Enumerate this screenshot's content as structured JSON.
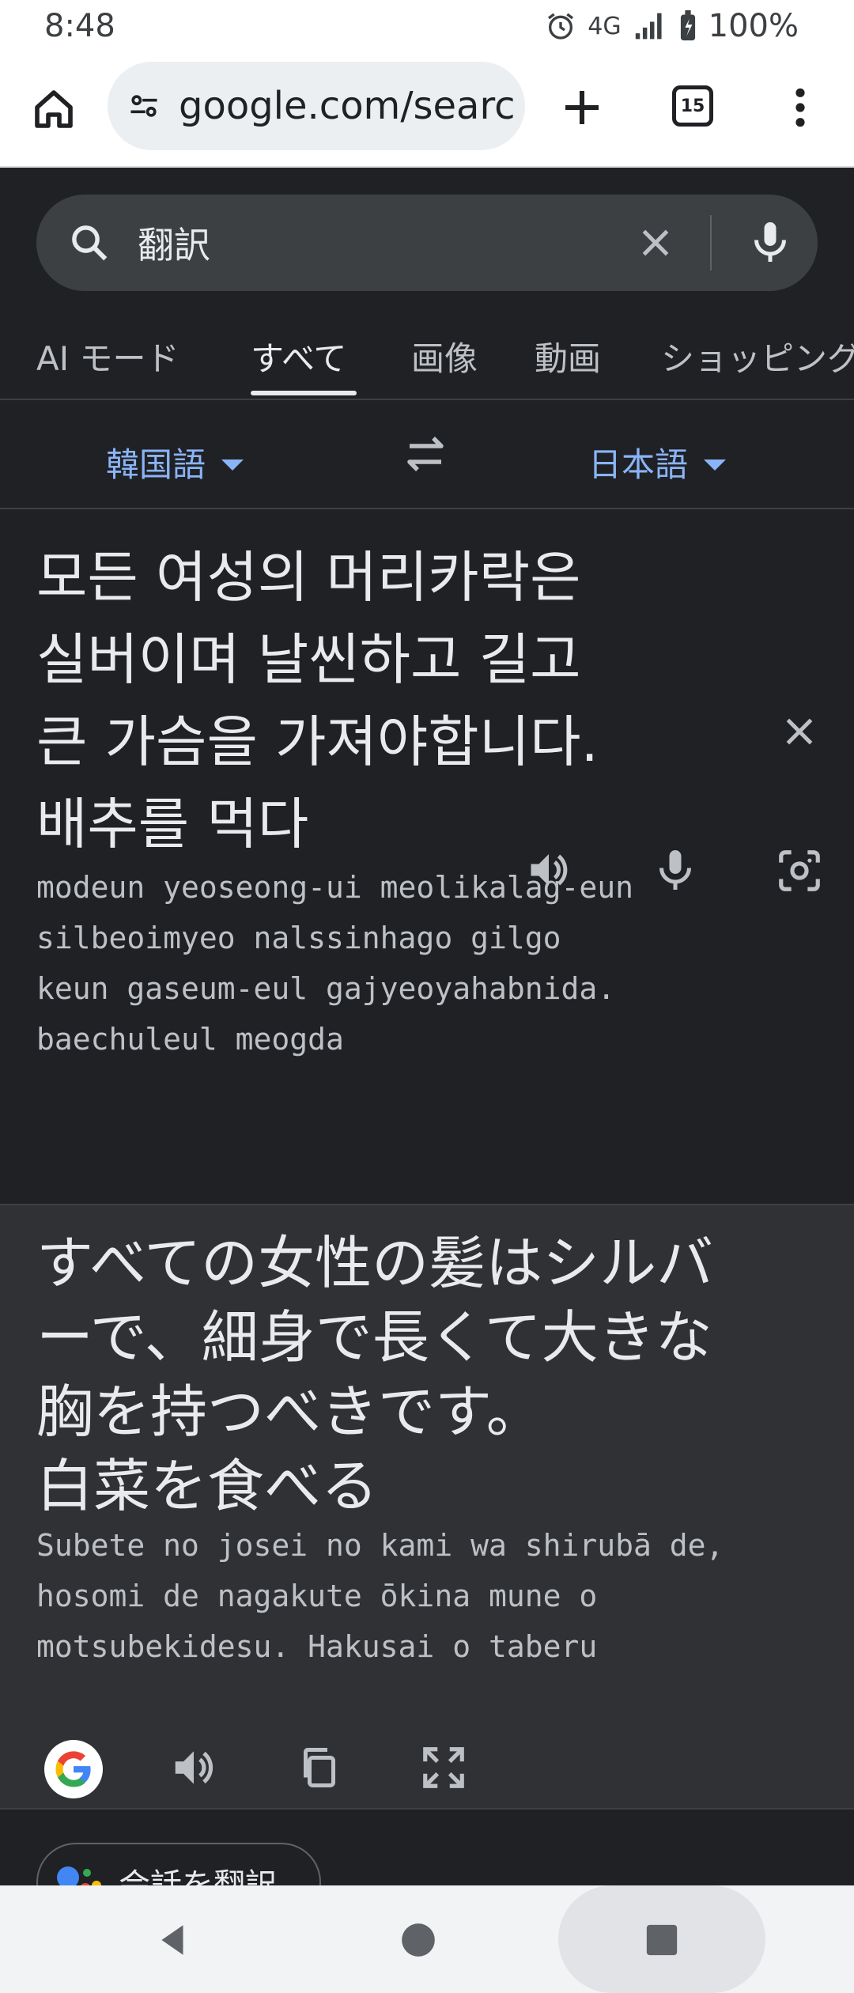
{
  "status_bar": {
    "time": "8:48",
    "network": "4G",
    "battery": "100%"
  },
  "browser": {
    "url": "google.com/searc",
    "tab_count": "15"
  },
  "search": {
    "query": "翻訳"
  },
  "tabs": [
    "AI モード",
    "すべて",
    "画像",
    "動画",
    "ショッピング"
  ],
  "translator": {
    "source_lang": "韓国語",
    "target_lang": "日本語",
    "source_lines": [
      "모든 여성의 머리카락은",
      "실버이며 날씬하고 길고",
      "큰 가슴을 가져야합니다.",
      "배추를 먹다"
    ],
    "source_roman_lines": [
      "modeun yeoseong-ui meolikalag-eun",
      "silbeoimyeo nalssinhago gilgo",
      "keun gaseum-eul gajyeoyahabnida.",
      "baechuleul meogda"
    ],
    "target_lines": [
      "すべての女性の髪はシルバ",
      "ーで、細身で長くて大きな",
      "胸を持つべきです。",
      "白菜を食べる"
    ],
    "target_roman_lines": [
      "Subete no josei no kami wa shirubā de,",
      "hosomi de nagakute ōkina mune o",
      "motsubekidesu. Hakusai o taberu"
    ]
  },
  "conversation_chip": "会話を翻訳",
  "icons": [
    "home-icon",
    "site-info-icon",
    "new-tab-icon",
    "tab-switcher-icon",
    "more-menu-icon",
    "search-icon",
    "clear-icon",
    "mic-icon",
    "swap-icon",
    "close-icon",
    "speaker-icon",
    "camera-icon",
    "google-g-icon",
    "copy-icon",
    "fullscreen-icon",
    "back-icon",
    "home-nav-icon",
    "recents-icon"
  ],
  "colors": {
    "accent": "#8ab4f8",
    "background": "#202124",
    "panel": "#303134"
  }
}
